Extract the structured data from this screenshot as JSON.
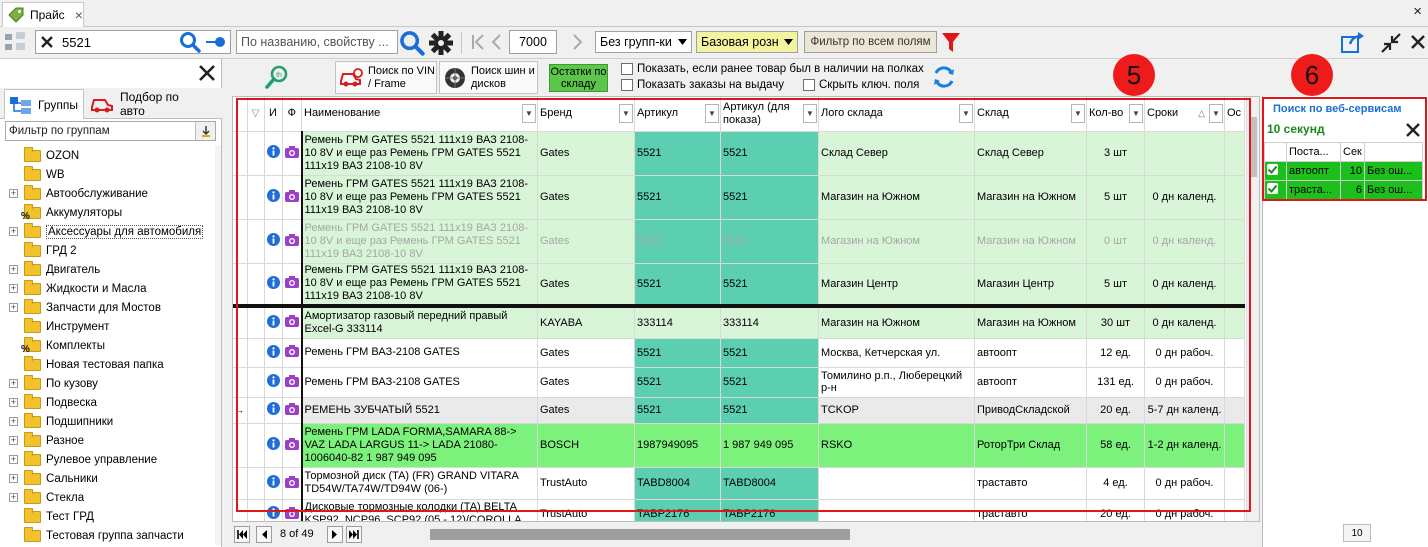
{
  "window": {
    "tab_title": "Прайс",
    "close_glyph": "×"
  },
  "toolbar": {
    "search_value": "5521",
    "name_search_placeholder": "По названию, свойству ...",
    "page_size": "7000",
    "group_mode": "Без групп-ки",
    "price_type": "Базовая розн",
    "filter_all_button": "Фильтр по всем полям"
  },
  "left": {
    "tab_groups": "Группы",
    "tab_auto": "Подбор по авто",
    "filter_placeholder": "Фильтр  по группам",
    "tree": [
      {
        "label": "OZON",
        "expand": false,
        "type": "folder"
      },
      {
        "label": "WB",
        "expand": false,
        "type": "folder"
      },
      {
        "label": "Автообслуживание",
        "expand": true,
        "type": "folder"
      },
      {
        "label": "Аккумуляторы",
        "expand": false,
        "type": "percent"
      },
      {
        "label": "Аксессуары для автомобиля",
        "expand": true,
        "type": "folder",
        "selected": true
      },
      {
        "label": "ГРД 2",
        "expand": false,
        "type": "folder"
      },
      {
        "label": "Двигатель",
        "expand": true,
        "type": "folder"
      },
      {
        "label": "Жидкости и Масла",
        "expand": true,
        "type": "folder"
      },
      {
        "label": "Запчасти для Мостов",
        "expand": true,
        "type": "folder"
      },
      {
        "label": "Инструмент",
        "expand": false,
        "type": "folder"
      },
      {
        "label": "Комплекты",
        "expand": false,
        "type": "percent"
      },
      {
        "label": "Новая тестовая папка",
        "expand": false,
        "type": "folder"
      },
      {
        "label": "По кузову",
        "expand": true,
        "type": "folder"
      },
      {
        "label": "Подвеска",
        "expand": true,
        "type": "folder"
      },
      {
        "label": "Подшипники",
        "expand": true,
        "type": "folder"
      },
      {
        "label": "Разное",
        "expand": true,
        "type": "folder"
      },
      {
        "label": "Рулевое управление",
        "expand": true,
        "type": "folder"
      },
      {
        "label": "Сальники",
        "expand": true,
        "type": "folder"
      },
      {
        "label": "Стекла",
        "expand": true,
        "type": "folder"
      },
      {
        "label": "Тест ГРД",
        "expand": false,
        "type": "folder"
      },
      {
        "label": "Тестовая группа запчасти",
        "expand": false,
        "type": "folder"
      }
    ]
  },
  "tb2": {
    "vin_button": "Поиск по VIN / Frame",
    "tires_button": "Поиск шин и дисков",
    "stock_button": "Остатки по складу",
    "cb_prev_stock": "Показать, если ранее товар был в наличии на полках",
    "cb_orders": "Показать заказы на выдачу",
    "cb_hide_key": "Скрыть ключ. поля"
  },
  "grid": {
    "headers": {
      "info": "И",
      "photo": "Ф",
      "name": "Наименование",
      "brand": "Бренд",
      "article": "Артикул",
      "article_disp": "Артикул (для показа)",
      "logo": "Лого склада",
      "warehouse": "Склад",
      "qty": "Кол-во",
      "terms": "Сроки",
      "rest": "Ос"
    },
    "rows": [
      {
        "name": "Ремень ГРМ GATES 5521 111х19 ВАЗ 2108-10 8V и еще раз Ремень ГРМ GATES 5521 111х19 ВАЗ 2108-10 8V",
        "brand": "Gates",
        "article": "5521",
        "article_disp": "5521",
        "logo": "Склад Север",
        "warehouse": "Склад Север",
        "qty": "3 шт",
        "terms": "",
        "style": "green"
      },
      {
        "name": "Ремень ГРМ GATES 5521 111х19 ВАЗ 2108-10 8V и еще раз Ремень ГРМ GATES 5521 111х19 ВАЗ 2108-10 8V",
        "brand": "Gates",
        "article": "5521",
        "article_disp": "5521",
        "logo": "Магазин на Южном",
        "warehouse": "Магазин на Южном",
        "qty": "5 шт",
        "terms": "0 дн календ.",
        "style": "green"
      },
      {
        "name": "Ремень ГРМ GATES 5521 111х19 ВАЗ 2108-10 8V и еще раз Ремень ГРМ GATES 5521 111х19 ВАЗ 2108-10 8V",
        "brand": "Gates",
        "article": "5521",
        "article_disp": "5521",
        "logo": "Магазин на Южном",
        "warehouse": "Магазин на Южном",
        "qty": "0 шт",
        "terms": "0 дн календ.",
        "style": "green-dim"
      },
      {
        "name": "Ремень ГРМ GATES 5521 111х19 ВАЗ 2108-10 8V и еще раз Ремень ГРМ GATES 5521 111х19 ВАЗ 2108-10 8V",
        "brand": "Gates",
        "article": "5521",
        "article_disp": "5521",
        "logo": "Магазин Центр",
        "warehouse": "Магазин Центр",
        "qty": "5 шт",
        "terms": "0 дн календ.",
        "style": "green-sep"
      },
      {
        "name": "Амортизатор газовый передний правый Excel-G 333114",
        "brand": "KAYABA",
        "article": "333114",
        "article_disp": "333114",
        "logo": "Магазин на Южном",
        "warehouse": "Магазин на Южном",
        "qty": "30 шт",
        "terms": "0 дн календ.",
        "style": "green-lite"
      },
      {
        "name": "Ремень ГРМ ВАЗ-2108 GATES",
        "brand": "Gates",
        "article": "5521",
        "article_disp": "5521",
        "logo": "Москва, Кетчерская ул.",
        "warehouse": "автоопт",
        "qty": "12 ед.",
        "terms": "0 дн рабоч.",
        "style": "white"
      },
      {
        "name": "Ремень ГРМ ВАЗ-2108 GATES",
        "brand": "Gates",
        "article": "5521",
        "article_disp": "5521",
        "logo": "Томилино р.п., Люберецкий р-н",
        "warehouse": "автоопт",
        "qty": "131 ед.",
        "terms": "0 дн рабоч.",
        "style": "white"
      },
      {
        "name": "РЕМЕНЬ ЗУБЧАТЫЙ 5521",
        "brand": "Gates",
        "article": "5521",
        "article_disp": "5521",
        "logo": "TCKOP",
        "warehouse": "ПриводСкладской",
        "qty": "20 ед.",
        "terms": "5-7 дн календ.",
        "style": "current"
      },
      {
        "name": "Ремень ГРМ LADA FORMA,SAMARA 88-> VAZ LADA LARGUS 11-> LADA 21080-1006040-82 1 987 949 095",
        "brand": "BOSCH",
        "article": "1987949095",
        "article_disp": "1 987 949 095",
        "logo": "RSKO",
        "warehouse": "РоторТри Склад",
        "qty": "58 ед.",
        "terms": "1-2 дн календ.",
        "style": "bright"
      },
      {
        "name": "Тормозной диск (TA) (FR) GRAND VITARA TD54W/TA74W/TD94W (06-)",
        "brand": "TrustAuto",
        "article": "TABD8004",
        "article_disp": "TABD8004",
        "logo": "",
        "warehouse": "траставто",
        "qty": "4 ед.",
        "terms": "0 дн рабоч.",
        "style": "white"
      },
      {
        "name": "Дисковые тормозные колодки (TA) BELTA KSP92, NCP96, SCP92 (05 - 12)/COROLLA",
        "brand": "TrustAuto",
        "article": "TABP2176",
        "article_disp": "TABP2176",
        "logo": "",
        "warehouse": "траставто",
        "qty": "20 ед.",
        "terms": "0 дн рабоч.",
        "style": "white"
      }
    ]
  },
  "pager": {
    "text": "8 of 49"
  },
  "right": {
    "title": "Поиск по веб-сервисам",
    "timer": "10 секунд",
    "col_supplier": "Поста...",
    "col_sec": "Сек",
    "rows": [
      {
        "supplier": "автоопт",
        "sec": "10",
        "status": "Без ош..."
      },
      {
        "supplier": "траста...",
        "sec": "6",
        "status": "Без ош..."
      }
    ],
    "footer_value": "10"
  },
  "badges": {
    "b5": "5",
    "b6": "6"
  },
  "colors": {
    "annotation_red": "#e0161b",
    "row_green": "#d8f5d8",
    "row_bright": "#7cf17c",
    "article_teal": "#5ccfb0",
    "accent_blue": "#1a6fd6"
  }
}
